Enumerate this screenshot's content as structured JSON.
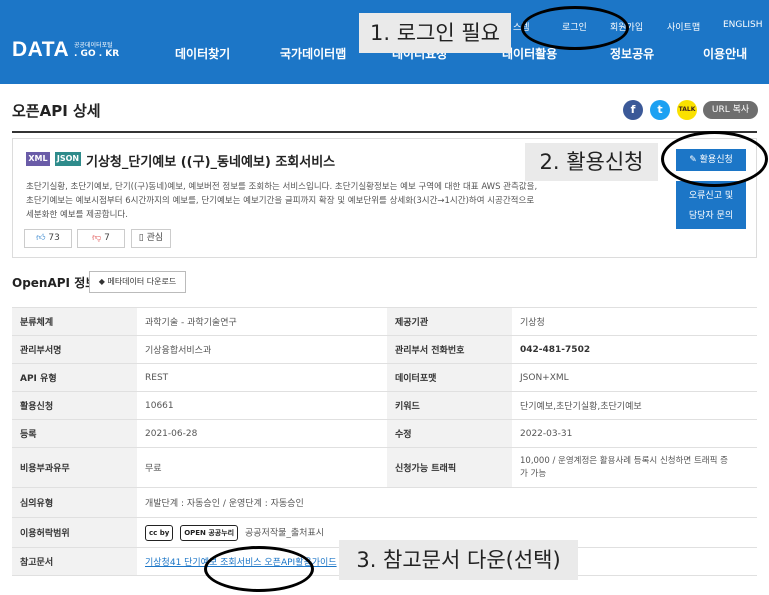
{
  "header": {
    "logo_main": "DATA",
    "logo_small_top": "공공데이터포털",
    "logo_small_bottom": ". GO . KR",
    "util_links": [
      "스템",
      "로그인",
      "회원가입",
      "사이트맵",
      "ENGLISH"
    ],
    "nav": [
      "데이터찾기",
      "국가데이터맵",
      "데이터요청",
      "데이터활용",
      "정보공유",
      "이용안내"
    ]
  },
  "page": {
    "title": "오픈API 상세",
    "url_copy": "URL 복사",
    "share": {
      "facebook": "f",
      "twitter": "t",
      "kakao": "TALK"
    }
  },
  "summary": {
    "badges": [
      "XML",
      "JSON"
    ],
    "title": "기상청_단기예보 ((구)_동네예보) 조회서비스",
    "description": [
      "초단기실황, 초단기예보, 단기((구)동네)예보, 예보버전 정보를 조회하는 서비스입니다. 초단기실황정보는 예보 구역에 대한 대표 AWS 관측값을,",
      "초단기예보는 예보시점부터 6시간까지의 예보를, 단기예보는 예보기간을 글피까지 확장 및 예보단위를 상세화(3시간→1시간)하여 시공간적으로",
      "세분화한 예보를 제공합니다."
    ],
    "likes": "73",
    "dislikes": "7",
    "interest": "관심",
    "apply_button": "활용신청",
    "report_button": [
      "오류신고 및",
      "담당자 문의"
    ]
  },
  "openapi": {
    "section_title": "OpenAPI 정보",
    "meta_download": "메타데이터 다운로드",
    "rows": [
      {
        "k1": "분류체계",
        "v1": "과학기술 - 과학기술연구",
        "k2": "제공기관",
        "v2": "기상청"
      },
      {
        "k1": "관리부서명",
        "v1": "기상융합서비스과",
        "k2": "관리부서 전화번호",
        "v2": "042-481-7502"
      },
      {
        "k1": "API 유형",
        "v1": "REST",
        "k2": "데이터포맷",
        "v2": "JSON+XML"
      },
      {
        "k1": "활용신청",
        "v1": "10661",
        "k2": "키워드",
        "v2": "단기예보,초단기실황,초단기예보"
      },
      {
        "k1": "등록",
        "v1": "2021-06-28",
        "k2": "수정",
        "v2": "2022-03-31"
      },
      {
        "k1": "비용부과유무",
        "v1": "무료",
        "k2": "신청가능 트래픽",
        "v2a": "10,000 / 운영계정은 활용사례 등록시 신청하면 트래픽 증",
        "v2b": "가 가능"
      }
    ],
    "approval_label": "심의유형",
    "approval_value": "개발단계 : 자동승인 / 운영단계 : 자동승인",
    "license_label": "이용허락범위",
    "license_icon_cc": "cc by",
    "license_icon_open": "OPEN 공공누리",
    "license_value": "공공저작물_출처표시",
    "reference_label": "참고문서",
    "reference_link": "기상청41 단기예보 조회서비스 오픈API활용가이드"
  },
  "annotations": {
    "step1": "1. 로그인 필요",
    "step2": "2. 활용신청",
    "step3": "3. 참고문서 다운(선택)"
  }
}
